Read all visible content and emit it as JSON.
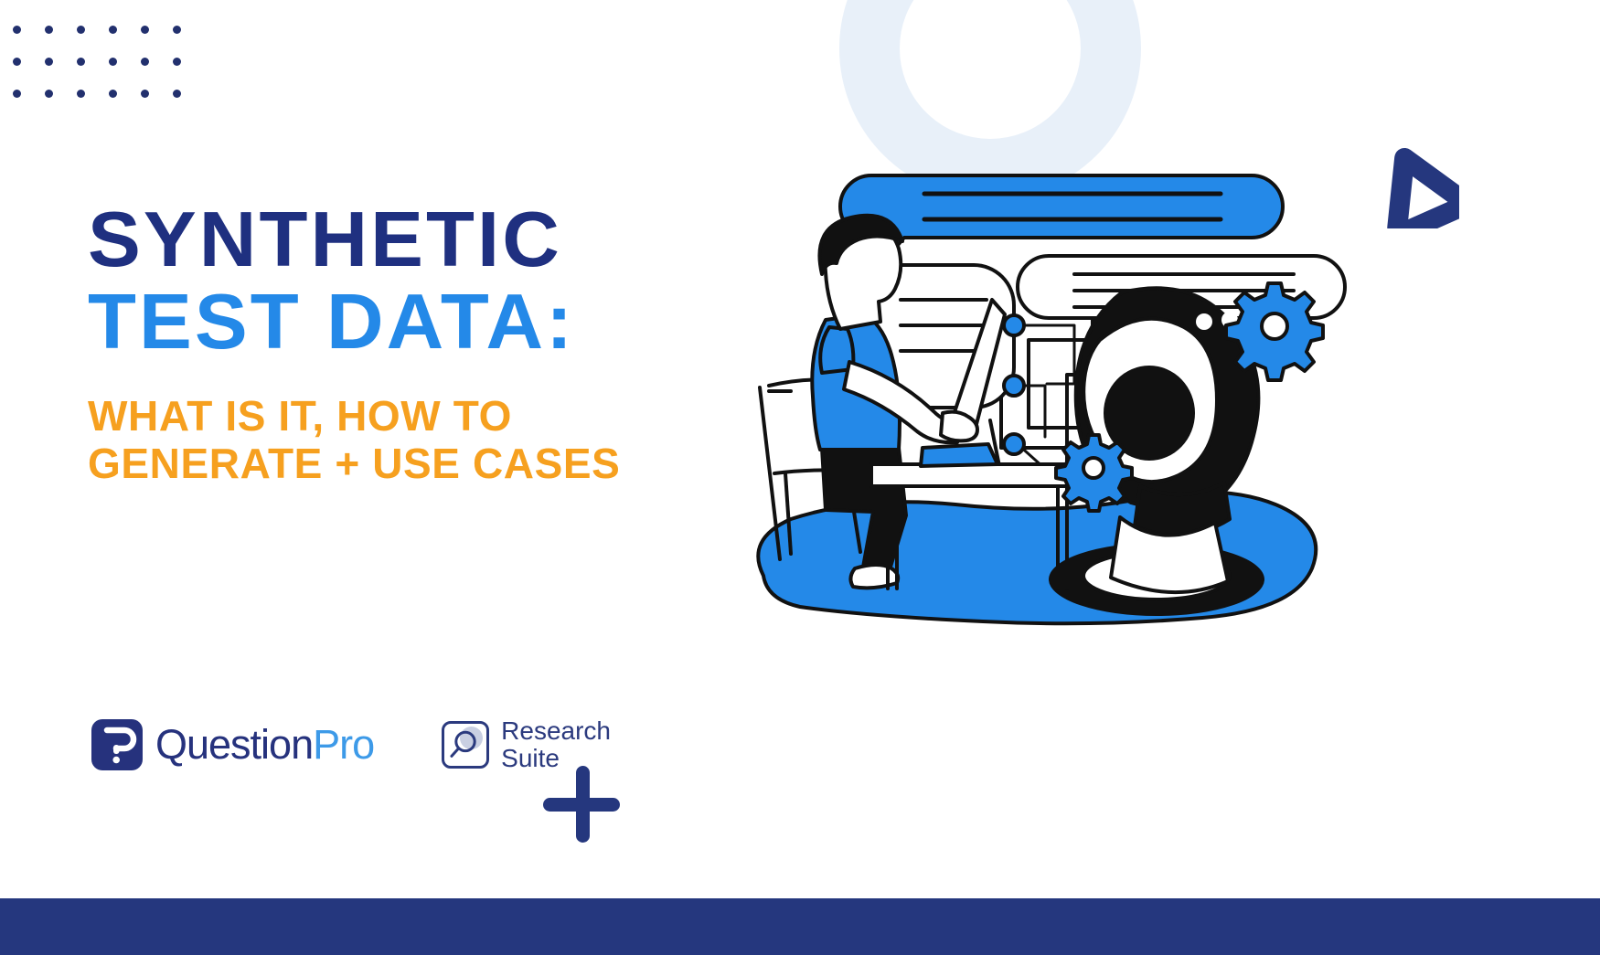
{
  "page": {
    "background_color": "#ffffff",
    "brand_navy": "#25377e",
    "brand_blue": "#2489e8",
    "brand_orange": "#f6a01f",
    "pale_blue": "#e8f0f9"
  },
  "headline": {
    "line1": "SYNTHETIC",
    "line2": "TEST DATA:",
    "line1_color": "#1f3080",
    "line2_color": "#2489e8"
  },
  "subtitle": {
    "line1": "WHAT IS IT, HOW TO",
    "line2": "GENERATE + USE CASES",
    "color": "#f6a01f"
  },
  "logos": {
    "questionpro": {
      "word_dark": "Question",
      "word_light": "Pro",
      "mark_icon": "questionpro-p-mark-icon",
      "mark_color": "#26327d",
      "accent_color": "#3d9ae8"
    },
    "research_suite": {
      "line1": "Research",
      "line2": "Suite",
      "mark_icon": "magnifier-square-icon",
      "color": "#2b3a7e"
    }
  },
  "decorations": {
    "dot_grid": {
      "columns": 6,
      "rows": 3,
      "color": "#22306e",
      "icon": "dot-grid-icon"
    },
    "pale_ring": {
      "color": "#e8f0f9",
      "icon": "ring-icon"
    },
    "send_badge": {
      "color": "#25377e",
      "icon": "send-triangle-icon"
    },
    "plus_mark": {
      "color": "#25377e",
      "icon": "plus-icon"
    },
    "bottom_bar": {
      "color": "#25377e"
    }
  },
  "illustration": {
    "name": "person-at-desk-with-ai-robot-illustration",
    "elements": [
      "speech-bubble-large",
      "speech-bubble-small",
      "speech-bubble-rounded",
      "person-seated-at-desk",
      "chair",
      "desk",
      "monitor",
      "keyboard",
      "node-connector-diagram",
      "robot-head",
      "gear-large",
      "gear-small",
      "blue-ground-blob"
    ],
    "palette": {
      "blue": "#2489e8",
      "black": "#111111",
      "white": "#ffffff"
    }
  }
}
